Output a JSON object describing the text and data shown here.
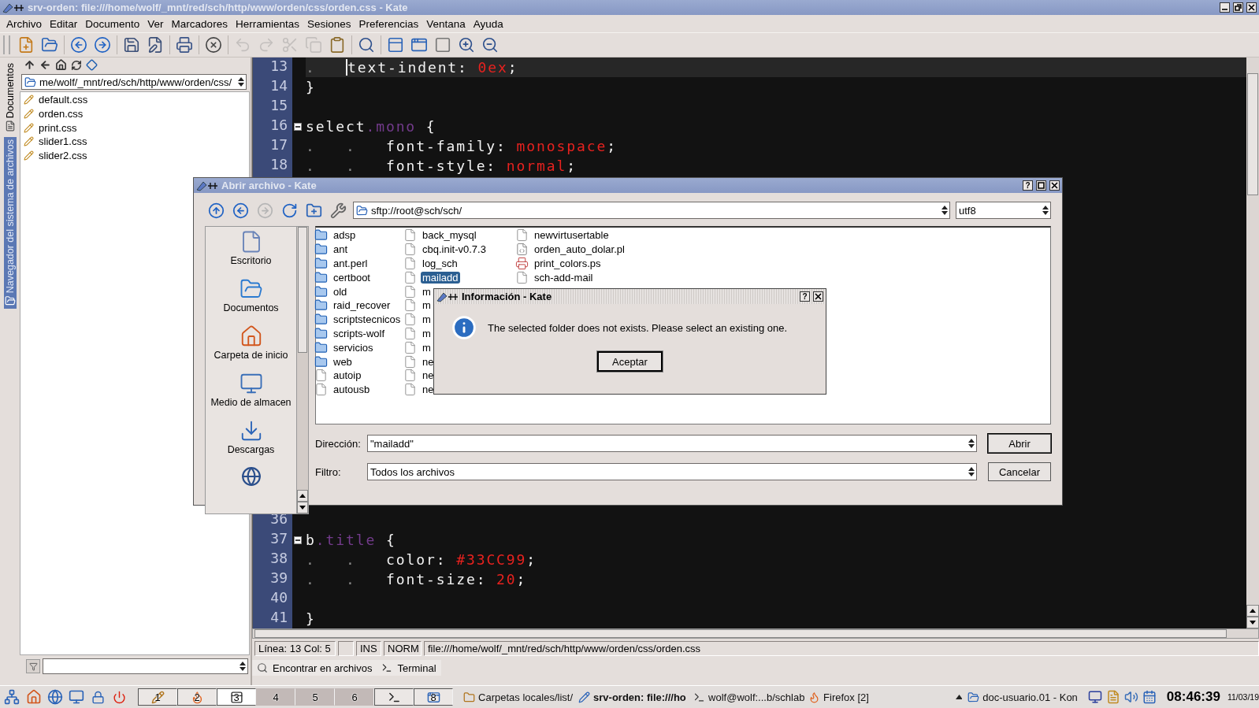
{
  "window": {
    "title": "srv-orden: file:///home/wolf/_mnt/red/sch/http/www/orden/css/orden.css - Kate"
  },
  "menu": [
    "Archivo",
    "Editar",
    "Documento",
    "Ver",
    "Marcadores",
    "Herramientas",
    "Sesiones",
    "Preferencias",
    "Ventana",
    "Ayuda"
  ],
  "toolbar": [
    {
      "disabled": false
    },
    {
      "disabled": false
    },
    {
      "disabled": false
    },
    {
      "disabled": false
    },
    {
      "disabled": false
    },
    {
      "disabled": false
    },
    {
      "disabled": false
    },
    {
      "disabled": false
    },
    {
      "disabled": true
    },
    {
      "disabled": true
    },
    {
      "disabled": true
    },
    {
      "disabled": true
    },
    {
      "disabled": false
    },
    {
      "disabled": false
    },
    {
      "disabled": false
    },
    {
      "disabled": false
    },
    {
      "disabled": false
    },
    {
      "disabled": false
    },
    {
      "disabled": false
    }
  ],
  "sidebar_tabs": [
    {
      "label": "Documentos",
      "selected": false
    },
    {
      "label": "Navegador del sistema de archivos",
      "selected": true
    }
  ],
  "file_browser": {
    "path": "me/wolf/_mnt/red/sch/http/www/orden/css/",
    "files": [
      "default.css",
      "orden.css",
      "print.css",
      "slider1.css",
      "slider2.css"
    ]
  },
  "editor": {
    "top_lines": [
      {
        "number": "13",
        "current": true,
        "fold": false,
        "segments": [
          {
            "kind": "tab",
            "text": "."
          },
          {
            "kind": "plain",
            "text": "text-indent: "
          },
          {
            "kind": "value",
            "text": "0ex"
          },
          {
            "kind": "plain",
            "text": ";"
          }
        ]
      },
      {
        "number": "14",
        "current": false,
        "fold": false,
        "segments": [
          {
            "kind": "plain",
            "text": "}"
          }
        ]
      },
      {
        "number": "15",
        "current": false,
        "fold": false
      },
      {
        "number": "16",
        "current": false,
        "fold": true,
        "segments": [
          {
            "kind": "plain",
            "text": "select"
          },
          {
            "kind": "selector",
            "text": ".mono"
          },
          {
            "kind": "plain",
            "text": " {"
          }
        ]
      },
      {
        "number": "17",
        "current": false,
        "fold": false,
        "segments": [
          {
            "kind": "tab",
            "text": "."
          },
          {
            "kind": "tab",
            "text": "."
          },
          {
            "kind": "plain",
            "text": "font-family: "
          },
          {
            "kind": "value",
            "text": "monospace"
          },
          {
            "kind": "plain",
            "text": ";"
          }
        ]
      },
      {
        "number": "18",
        "current": false,
        "fold": false,
        "segments": [
          {
            "kind": "tab",
            "text": "."
          },
          {
            "kind": "tab",
            "text": "."
          },
          {
            "kind": "plain",
            "text": "font-style: "
          },
          {
            "kind": "value",
            "text": "normal"
          },
          {
            "kind": "plain",
            "text": ";"
          }
        ]
      }
    ],
    "bottom_lines": [
      {
        "number": "36",
        "current": false,
        "fold": false
      },
      {
        "number": "37",
        "current": false,
        "fold": true,
        "segments": [
          {
            "kind": "plain",
            "text": "b"
          },
          {
            "kind": "selector",
            "text": ".title"
          },
          {
            "kind": "plain",
            "text": " {"
          }
        ]
      },
      {
        "number": "38",
        "current": false,
        "fold": false,
        "segments": [
          {
            "kind": "tab",
            "text": "."
          },
          {
            "kind": "tab",
            "text": "."
          },
          {
            "kind": "plain",
            "text": "color: "
          },
          {
            "kind": "value",
            "text": "#33CC99"
          },
          {
            "kind": "plain",
            "text": ";"
          }
        ]
      },
      {
        "number": "39",
        "current": false,
        "fold": false,
        "segments": [
          {
            "kind": "tab",
            "text": "."
          },
          {
            "kind": "tab",
            "text": "."
          },
          {
            "kind": "plain",
            "text": "font-size: "
          },
          {
            "kind": "value",
            "text": "20"
          },
          {
            "kind": "plain",
            "text": ";"
          }
        ]
      },
      {
        "number": "40",
        "current": false,
        "fold": false
      },
      {
        "number": "41",
        "current": false,
        "fold": false,
        "segments": [
          {
            "kind": "plain",
            "text": "}"
          }
        ]
      }
    ]
  },
  "status_bar": {
    "position": "Línea: 13 Col: 5",
    "mode": "INS",
    "input": "NORM",
    "path": "file:///home/wolf/_mnt/red/sch/http/www/orden/css/orden.css"
  },
  "tool_tabs": [
    "Encontrar en archivos",
    "Terminal"
  ],
  "open_dialog": {
    "title": "Abrir archivo - Kate",
    "help_button": "?",
    "toolbar": [
      {
        "disabled": false
      },
      {
        "disabled": false
      },
      {
        "disabled": true
      },
      {
        "disabled": false
      },
      {
        "disabled": false
      },
      {
        "disabled": false
      }
    ],
    "location": "sftp://root@sch/sch/",
    "encoding": "utf8",
    "places": [
      "Escritorio",
      "Documentos",
      "Carpeta de inicio",
      "Medio de almacen",
      "Descargas"
    ],
    "columns": [
      [
        {
          "name": "adsp",
          "kind": "folder",
          "selected": false
        },
        {
          "name": "ant",
          "kind": "folder",
          "selected": false
        },
        {
          "name": "ant.perl",
          "kind": "folder",
          "selected": false
        },
        {
          "name": "certboot",
          "kind": "folder",
          "selected": false
        },
        {
          "name": "old",
          "kind": "folder",
          "selected": false
        },
        {
          "name": "raid_recover",
          "kind": "folder",
          "selected": false
        },
        {
          "name": "scriptstecnicos",
          "kind": "folder",
          "selected": false
        },
        {
          "name": "scripts-wolf",
          "kind": "folder",
          "selected": false
        },
        {
          "name": "servicios",
          "kind": "folder",
          "selected": false
        },
        {
          "name": "web",
          "kind": "folder",
          "selected": false
        },
        {
          "name": "autoip",
          "kind": "file",
          "selected": false
        },
        {
          "name": "autousb",
          "kind": "file",
          "selected": false
        }
      ],
      [
        {
          "name": "back_mysql",
          "kind": "file",
          "selected": false
        },
        {
          "name": "cbq.init-v0.7.3",
          "kind": "file",
          "selected": false
        },
        {
          "name": "log_sch",
          "kind": "file",
          "selected": false
        },
        {
          "name": "mailadd",
          "kind": "file",
          "selected": true
        },
        {
          "name": "m",
          "kind": "file",
          "selected": false
        },
        {
          "name": "m",
          "kind": "file",
          "selected": false
        },
        {
          "name": "m",
          "kind": "file",
          "selected": false
        },
        {
          "name": "m",
          "kind": "file",
          "selected": false
        },
        {
          "name": "m",
          "kind": "file",
          "selected": false
        },
        {
          "name": "ne",
          "kind": "file",
          "selected": false
        },
        {
          "name": "ne",
          "kind": "file",
          "selected": false
        },
        {
          "name": "ne",
          "kind": "file",
          "selected": false
        }
      ],
      [
        {
          "name": "newvirtusertable",
          "kind": "file",
          "selected": false
        },
        {
          "name": "orden_auto_dolar.pl",
          "kind": "script",
          "selected": false
        },
        {
          "name": "print_colors.ps",
          "kind": "print",
          "selected": false
        },
        {
          "name": "sch-add-mail",
          "kind": "file",
          "selected": false
        }
      ]
    ],
    "location_label": "Dirección:",
    "location_value": "\"mailadd\"",
    "filter_label": "Filtro:",
    "filter_value": "Todos los archivos",
    "buttons": [
      "Abrir",
      "Cancelar"
    ]
  },
  "info_dialog": {
    "title": "Información - Kate",
    "help_button": "?",
    "message": "The selected folder does not exists. Please select an existing one.",
    "button": "Aceptar"
  },
  "taskbar": {
    "pager": [
      {
        "label": "1",
        "selected": false,
        "occupied": true
      },
      {
        "label": "2",
        "selected": false,
        "occupied": true
      },
      {
        "label": "3",
        "selected": true,
        "occupied": true
      },
      {
        "label": "4",
        "selected": false,
        "occupied": false
      },
      {
        "label": "5",
        "selected": false,
        "occupied": false
      },
      {
        "label": "6",
        "selected": false,
        "occupied": false
      },
      {
        "selected": false,
        "occupied": true
      },
      {
        "label": "8",
        "selected": false,
        "occupied": true
      }
    ],
    "tasks": [
      {
        "label": "Carpetas locales/list/",
        "active": false
      },
      {
        "label": "srv-orden: file:///ho",
        "active": true
      },
      {
        "label": "wolf@wolf:...b/schlab",
        "active": false
      },
      {
        "label": "Firefox [2]",
        "active": false
      }
    ],
    "tray_tasks": [
      {
        "label": "doc-usuario.01 - Kon",
        "active": false
      }
    ],
    "clock": "08:46:39",
    "date": "11/03/19"
  }
}
